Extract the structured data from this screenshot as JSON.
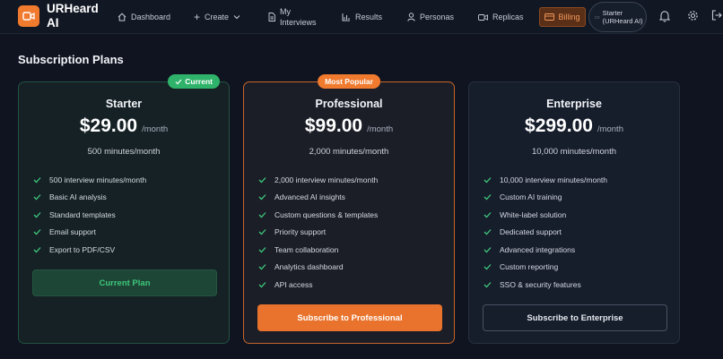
{
  "app": {
    "name": "URHeard AI"
  },
  "nav": {
    "dashboard": "Dashboard",
    "create": "Create",
    "interviews": "My Interviews",
    "results": "Results",
    "personas": "Personas",
    "replicas": "Replicas",
    "billing": "Billing"
  },
  "user": {
    "label": "Starter (URHeard AI)"
  },
  "page": {
    "title": "Subscription Plans"
  },
  "colors": {
    "accent": "#f07a2e",
    "success": "#2fb36a",
    "background": "#0f1420"
  },
  "plans": [
    {
      "name": "Starter",
      "price": "$29.00",
      "period": "/month",
      "minutes": "500 minutes/month",
      "badge": "Current",
      "features": [
        "500 interview minutes/month",
        "Basic AI analysis",
        "Standard templates",
        "Email support",
        "Export to PDF/CSV"
      ],
      "cta": "Current Plan"
    },
    {
      "name": "Professional",
      "price": "$99.00",
      "period": "/month",
      "minutes": "2,000 minutes/month",
      "badge": "Most Popular",
      "features": [
        "2,000 interview minutes/month",
        "Advanced AI insights",
        "Custom questions & templates",
        "Priority support",
        "Team collaboration",
        "Analytics dashboard",
        "API access"
      ],
      "cta": "Subscribe to Professional"
    },
    {
      "name": "Enterprise",
      "price": "$299.00",
      "period": "/month",
      "minutes": "10,000 minutes/month",
      "features": [
        "10,000 interview minutes/month",
        "Custom AI training",
        "White-label solution",
        "Dedicated support",
        "Advanced integrations",
        "Custom reporting",
        "SSO & security features"
      ],
      "cta": "Subscribe to Enterprise"
    }
  ]
}
